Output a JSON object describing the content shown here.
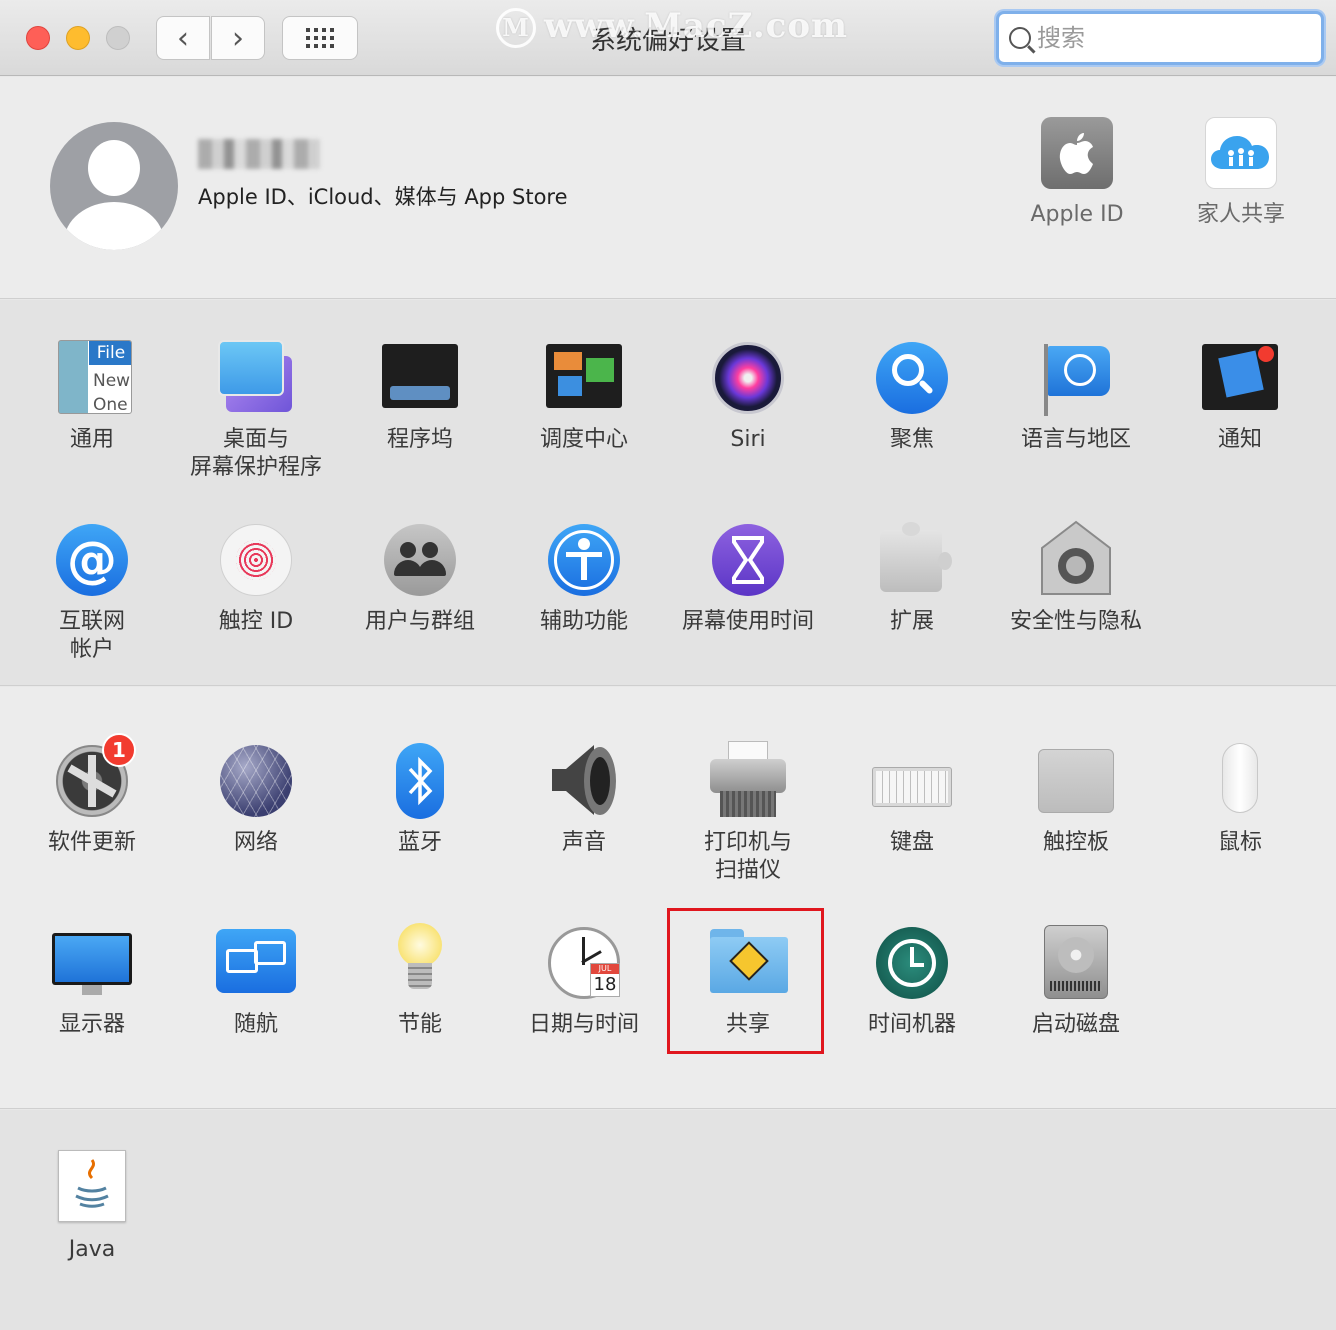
{
  "window": {
    "title": "系统偏好设置",
    "watermark": "www.MacZ.com",
    "watermark_logo": "M"
  },
  "toolbar": {
    "back_glyph": "‹",
    "forward_glyph": "›",
    "search_placeholder": "搜索"
  },
  "account": {
    "subtitle": "Apple ID、iCloud、媒体与 App Store",
    "top_panes": [
      {
        "label": "Apple ID",
        "icon": "apple-icon"
      },
      {
        "label": "家人共享",
        "icon": "family-sharing-icon"
      }
    ]
  },
  "section_a": [
    {
      "label": "通用",
      "icon": "general-icon",
      "icon_text_1": "File",
      "icon_text_2": "New",
      "icon_text_3": "One"
    },
    {
      "label": "桌面与\n屏幕保护程序",
      "icon": "desktop-screensaver-icon"
    },
    {
      "label": "程序坞",
      "icon": "dock-icon"
    },
    {
      "label": "调度中心",
      "icon": "mission-control-icon"
    },
    {
      "label": "Siri",
      "icon": "siri-icon"
    },
    {
      "label": "聚焦",
      "icon": "spotlight-icon"
    },
    {
      "label": "语言与地区",
      "icon": "language-region-icon"
    },
    {
      "label": "通知",
      "icon": "notifications-icon"
    },
    {
      "label": "互联网\n帐户",
      "icon": "internet-accounts-icon",
      "icon_text": "@"
    },
    {
      "label": "触控 ID",
      "icon": "touch-id-icon"
    },
    {
      "label": "用户与群组",
      "icon": "users-groups-icon"
    },
    {
      "label": "辅助功能",
      "icon": "accessibility-icon"
    },
    {
      "label": "屏幕使用时间",
      "icon": "screen-time-icon"
    },
    {
      "label": "扩展",
      "icon": "extensions-icon"
    },
    {
      "label": "安全性与隐私",
      "icon": "security-privacy-icon"
    }
  ],
  "section_b": [
    {
      "label": "软件更新",
      "icon": "software-update-icon",
      "badge": "1"
    },
    {
      "label": "网络",
      "icon": "network-icon"
    },
    {
      "label": "蓝牙",
      "icon": "bluetooth-icon"
    },
    {
      "label": "声音",
      "icon": "sound-icon"
    },
    {
      "label": "打印机与\n扫描仪",
      "icon": "printers-scanners-icon"
    },
    {
      "label": "键盘",
      "icon": "keyboard-icon"
    },
    {
      "label": "触控板",
      "icon": "trackpad-icon"
    },
    {
      "label": "鼠标",
      "icon": "mouse-icon"
    },
    {
      "label": "显示器",
      "icon": "displays-icon"
    },
    {
      "label": "随航",
      "icon": "sidecar-icon"
    },
    {
      "label": "节能",
      "icon": "energy-saver-icon"
    },
    {
      "label": "日期与时间",
      "icon": "date-time-icon",
      "icon_month": "JUL",
      "icon_day": "18"
    },
    {
      "label": "共享",
      "icon": "sharing-icon",
      "highlighted": true
    },
    {
      "label": "时间机器",
      "icon": "time-machine-icon"
    },
    {
      "label": "启动磁盘",
      "icon": "startup-disk-icon"
    }
  ],
  "section_c": [
    {
      "label": "Java",
      "icon": "java-icon"
    }
  ],
  "colors": {
    "highlight_border": "#e0161e",
    "badge": "#f23b2f",
    "search_focus": "#7fb0ea"
  }
}
